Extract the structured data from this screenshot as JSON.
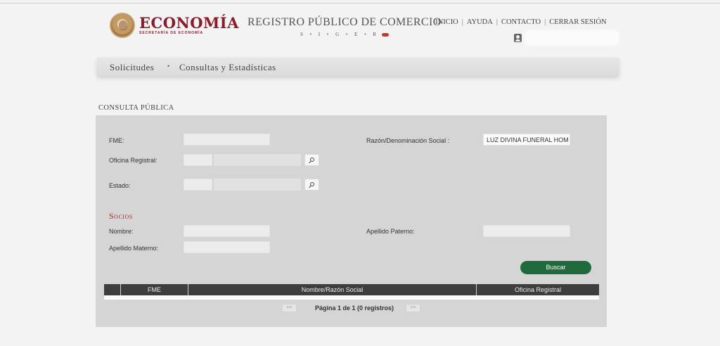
{
  "header": {
    "logo_title": "ECONOMÍA",
    "logo_sub": "SECRETARÍA DE ECONOMÍA",
    "registro_title": "REGISTRO PÚBLICO DE COMERCIO",
    "registro_sub": "S • I • G • E • R",
    "nav": {
      "inicio": "INICIO",
      "ayuda": "AYUDA",
      "contacto": "CONTACTO",
      "cerrar": "CERRAR SESIÓN",
      "separator": "|"
    }
  },
  "menu": {
    "solicitudes": "Solicitudes",
    "dot": "•",
    "consultas": "Consultas y Estadísticas"
  },
  "section_title": "CONSULTA PÚBLICA",
  "form": {
    "fme_label": "FME:",
    "fme_value": "",
    "oficina_label": "Oficina Registral:",
    "estado_label": "Estado:",
    "razon_label": "Razón/Denominación Social :",
    "razon_value": "LUZ DIVINA FUNERAL HOM",
    "socios_title": "Socios",
    "nombre_label": "Nombre:",
    "apellido_paterno_label": "Apellido Paterno:",
    "apellido_materno_label": "Apellido Materno:",
    "buscar_label": "Buscar"
  },
  "table": {
    "columns": [
      "",
      "FME",
      "Nombre/Razón Social",
      "Oficina Registral"
    ]
  },
  "pager": {
    "prev": "<<",
    "next": ">>",
    "text": "Página 1 de 1 (0 registros)"
  },
  "colors": {
    "brand": "#8a1b2a",
    "button": "#1e6a3d",
    "table_header": "#3e3e3e",
    "panel": "#d5d5d5"
  }
}
